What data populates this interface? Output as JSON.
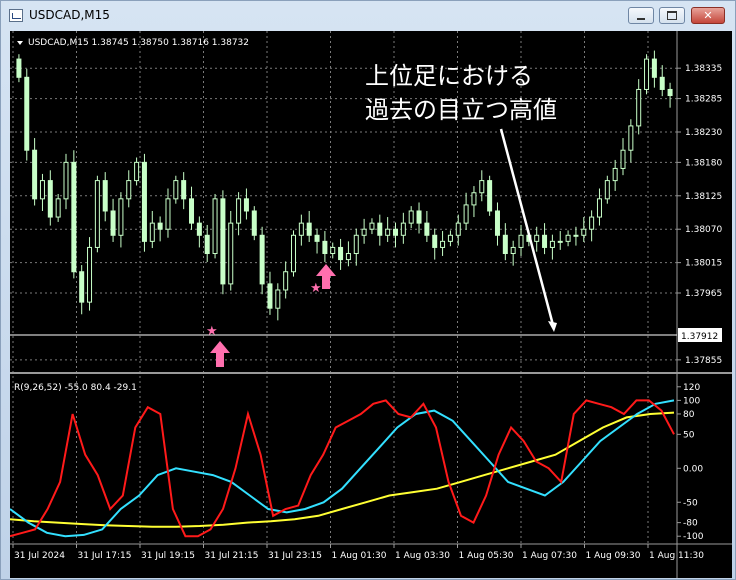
{
  "window": {
    "title": "USDCAD,M15"
  },
  "window_controls": {
    "minimize": "minimize",
    "maximize": "maximize",
    "close": "✕"
  },
  "price_chart": {
    "header": "USDCAD,M15  1.38745 1.38750 1.38716 1.38732",
    "y_ticks": [
      "1.38335",
      "1.38285",
      "1.38230",
      "1.38180",
      "1.38125",
      "1.38070",
      "1.38015",
      "1.37965",
      "1.37855"
    ],
    "hline_price": 1.37912,
    "hline_label": "1.37912"
  },
  "annotation": {
    "line1": "上位足における",
    "line2": "過去の目立つ高値"
  },
  "indicator": {
    "label": "R(9,26,52) -55.0 80.4 -29.1",
    "y_ticks": [
      "120",
      "100",
      "80",
      "50",
      "0.00",
      "-50",
      "-80",
      "-100"
    ]
  },
  "x_axis": {
    "labels": [
      "31 Jul 2024",
      "31 Jul 17:15",
      "31 Jul 19:15",
      "31 Jul 21:15",
      "31 Jul 23:15",
      "1 Aug 01:30",
      "1 Aug 03:30",
      "1 Aug 05:30",
      "1 Aug 07:30",
      "1 Aug 09:30",
      "1 Aug 11:30"
    ]
  },
  "colors": {
    "candle": "#c8ffc8",
    "grid": "#7a7a7a",
    "red_line": "#ff1a1a",
    "cyan_line": "#33e0ff",
    "yellow_line": "#ffff33",
    "marker": "#ff6fae"
  },
  "chart_data": {
    "type": "line",
    "candle_close_approx": [
      1.3832,
      1.382,
      1.3812,
      1.3815,
      1.3809,
      1.3812,
      1.3818,
      1.38,
      1.3795,
      1.3804,
      1.3815,
      1.381,
      1.3806,
      1.3812,
      1.3815,
      1.3818,
      1.3805,
      1.3808,
      1.3807,
      1.3812,
      1.3815,
      1.3812,
      1.3808,
      1.3806,
      1.3803,
      1.3812,
      1.3798,
      1.3808,
      1.3812,
      1.381,
      1.3806,
      1.3798,
      1.3794,
      1.3797,
      1.38,
      1.3806,
      1.3808,
      1.3806,
      1.3805,
      1.3803,
      1.3804,
      1.3802,
      1.3803,
      1.3806,
      1.3807,
      1.3808,
      1.3806,
      1.3807,
      1.3806,
      1.3808,
      1.381,
      1.3808,
      1.3806,
      1.3804,
      1.3805,
      1.3806,
      1.3808,
      1.3811,
      1.3813,
      1.3815,
      1.381,
      1.3806,
      1.3803,
      1.3804,
      1.3806,
      1.3805,
      1.3806,
      1.3804,
      1.3805,
      1.3805,
      1.3806,
      1.3806,
      1.3807,
      1.3809,
      1.3812,
      1.3815,
      1.3817,
      1.382,
      1.3824,
      1.383,
      1.3835,
      1.3832,
      1.383,
      1.3829
    ],
    "red_approx": [
      -100,
      -95,
      -90,
      -60,
      -20,
      80,
      20,
      -10,
      -60,
      -40,
      60,
      90,
      80,
      -60,
      -100,
      -100,
      -90,
      -60,
      0,
      80,
      20,
      -70,
      -60,
      -55,
      -10,
      20,
      60,
      70,
      80,
      95,
      100,
      80,
      75,
      95,
      60,
      -20,
      -70,
      -80,
      -40,
      20,
      60,
      40,
      10,
      0,
      -20,
      80,
      100,
      95,
      90,
      80,
      100,
      100,
      85,
      50
    ],
    "cyan_approx": [
      -60,
      -80,
      -95,
      -100,
      -98,
      -90,
      -60,
      -40,
      -10,
      0,
      -5,
      -10,
      -20,
      -40,
      -60,
      -65,
      -60,
      -50,
      -30,
      0,
      30,
      60,
      80,
      85,
      70,
      40,
      10,
      -20,
      -30,
      -40,
      -20,
      10,
      40,
      60,
      80,
      95,
      100
    ],
    "yellow_approx": [
      -75,
      -78,
      -80,
      -82,
      -84,
      -85,
      -86,
      -86,
      -85,
      -83,
      -80,
      -78,
      -75,
      -70,
      -60,
      -50,
      -40,
      -35,
      -30,
      -20,
      -10,
      0,
      10,
      20,
      40,
      60,
      75,
      80,
      82
    ]
  }
}
